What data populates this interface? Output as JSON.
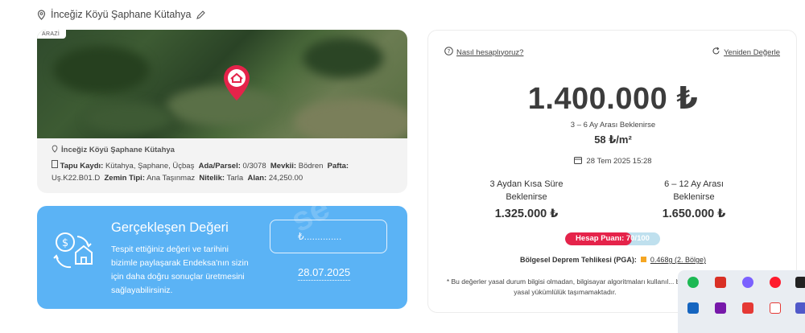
{
  "header": {
    "location": "İnceğiz Köyü Şaphane Kütahya"
  },
  "map": {
    "tag": "ARAZİ",
    "location": "İnceğiz Köyü Şaphane Kütahya",
    "tapu_label": "Tapu Kaydı:",
    "tapu_value": "Kütahya, Şaphane, Üçbaş",
    "ada_label": "Ada/Parsel:",
    "ada_value": "0/3078",
    "mevkii_label": "Mevkii:",
    "mevkii_value": "Bödren",
    "pafta_label": "Pafta:",
    "pafta_value": "Uş.K22.B01.D",
    "zemin_label": "Zemin Tipi:",
    "zemin_value": "Ana Taşınmaz",
    "nitelik_label": "Nitelik:",
    "nitelik_value": "Tarla",
    "alan_label": "Alan:",
    "alan_value": "24,250.00"
  },
  "realized": {
    "title": "Gerçekleşen Değeri",
    "text": "Tespit ettiğiniz değeri ve tarihini bizimle paylaşarak Endeksa'nın sizin için daha doğru sonuçlar üretmesini sağlayabilirsiniz.",
    "value_placeholder": "₺..............",
    "date": "28.07.2025",
    "watermark": "se"
  },
  "valuation": {
    "help_label": "Nasıl hesaplıyoruz?",
    "revalue_label": "Yeniden Değerle",
    "price": "1.400.000 ₺",
    "price_subtitle": "3 – 6 Ay Arası Beklenirse",
    "per_m2": "58 ₺/m²",
    "date": "28 Tem 2025 15:28",
    "short_title_1": "3 Aydan Kısa Süre",
    "short_title_2": "Beklenirse",
    "short_price": "1.325.000 ₺",
    "long_title_1": "6 – 12 Ay Arası",
    "long_title_2": "Beklenirse",
    "long_price": "1.650.000 ₺",
    "score_label": "Hesap Puanı: 70/100",
    "score_value": 70,
    "quake_label": "Bölgesel Deprem Tehlikesi (PGA):",
    "quake_value": "0.468g (2. Bölge)",
    "note": "* Bu değerler yasal durum bilgisi olmadan, bilgisayar algoritmaları kullanıl... bir yasal yükümlülük taşımamaktadır."
  },
  "colors": {
    "accent": "#e5234a",
    "blue_card": "#5bb3f5",
    "score_track": "#bfe0ee",
    "quake": "#f5a623"
  }
}
